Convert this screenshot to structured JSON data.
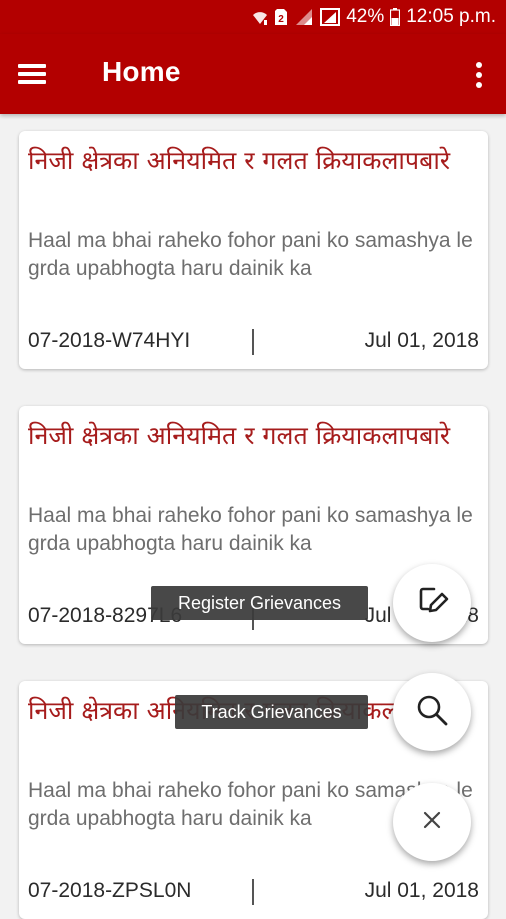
{
  "status_bar": {
    "battery": "42%",
    "time": "12:05 p.m.",
    "icons": [
      "wifi-icon",
      "sim-2-icon",
      "signal-icon",
      "signal-icon",
      "battery-icon"
    ]
  },
  "app_bar": {
    "title": "Home",
    "menu_icon": "hamburger-menu-icon",
    "overflow_icon": "more-vert-icon"
  },
  "grievances": [
    {
      "title": "निजी क्षेत्रका अनियमित र गलत क्रियाकलापबारे",
      "description": "Haal ma bhai raheko fohor pani ko samashya le grda upabhogta haru dainik ka",
      "id": "07-2018-W74HYI",
      "date": "Jul 01, 2018"
    },
    {
      "title": "निजी क्षेत्रका अनियमित र गलत क्रियाकलापबारे",
      "description": "Haal ma bhai raheko fohor pani ko samashya le grda upabhogta haru dainik ka",
      "id": "07-2018-8297L6",
      "date": "Jul 01, 2018"
    },
    {
      "title": "निजी क्षेत्रका अनियमित र गलत क्रियाकलापबारे",
      "description": "Haal ma bhai raheko fohor pani ko samashya le grda upabhogta haru dainik ka",
      "id": "07-2018-ZPSL0N",
      "date": "Jul 01, 2018"
    }
  ],
  "fab_menu": {
    "register_label": "Register Grievances",
    "register_icon": "edit-note-icon",
    "track_label": "Track Grievances",
    "track_icon": "search-icon",
    "close_icon": "close-icon"
  },
  "colors": {
    "primary": "#b30000",
    "title_text": "#a61c1c",
    "body_text": "#6e6e6e",
    "background": "#f2f2f2"
  }
}
